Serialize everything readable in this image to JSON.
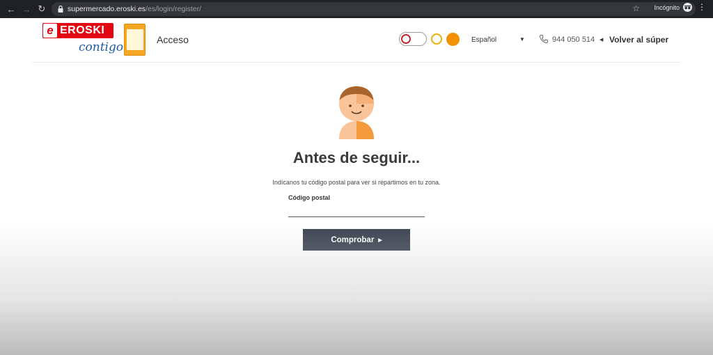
{
  "browser": {
    "url_host": "supermercado.eroski.es",
    "url_path": "/es/login/register/",
    "incognito_label": "Incógnito"
  },
  "header": {
    "logo_brand": "EROSKI",
    "logo_tagline": "contigo",
    "page_name": "Acceso",
    "language": "Español",
    "phone": "944 050 514",
    "back_link": "Volver al súper"
  },
  "main": {
    "title": "Antes de seguir...",
    "subtitle": "Indícanos tu código postal para ver si repartimos en tu zona.",
    "postal_label": "Código postal",
    "postal_value": "",
    "submit_label": "Comprobar"
  },
  "colors": {
    "brand_red": "#e30613",
    "button_dark": "#3d4352",
    "avatar_orange": "#f39a3c"
  }
}
